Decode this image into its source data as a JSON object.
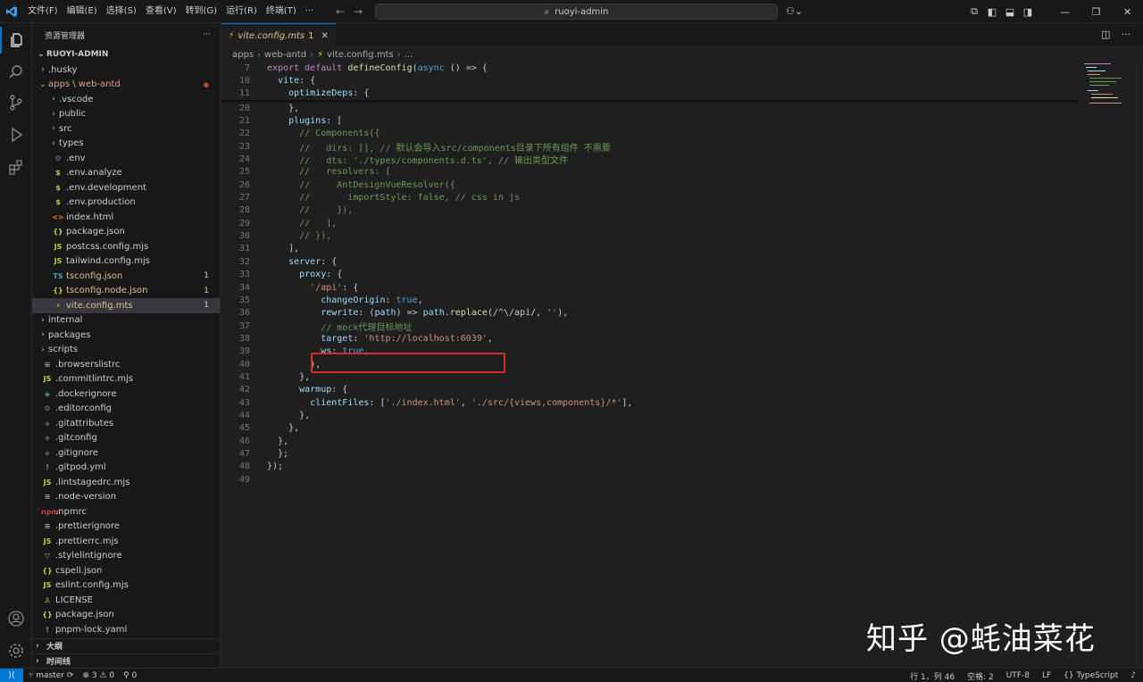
{
  "titlebar": {
    "menu": [
      "文件(F)",
      "编辑(E)",
      "选择(S)",
      "查看(V)",
      "转到(G)",
      "运行(R)",
      "终端(T)",
      "···"
    ],
    "search_text": "ruoyi-admin",
    "copilot": "⚇⌄"
  },
  "sidebar": {
    "title": "资源管理器",
    "more": "···",
    "project": "RUOYI-ADMIN",
    "items": [
      {
        "label": ".husky",
        "icon": "folder",
        "indent": 1,
        "chev": "›"
      },
      {
        "label": "apps \\ web-antd",
        "icon": "folder-open",
        "indent": 1,
        "chev": "⌄",
        "mod": true,
        "badge": "●"
      },
      {
        "label": ".vscode",
        "icon": "folder",
        "indent": 2,
        "chev": "›"
      },
      {
        "label": "public",
        "icon": "folder",
        "indent": 2,
        "chev": "›"
      },
      {
        "label": "src",
        "icon": "folder",
        "indent": 2,
        "chev": "›"
      },
      {
        "label": "types",
        "icon": "folder",
        "indent": 2,
        "chev": "›"
      },
      {
        "label": ".env",
        "icon": "gear",
        "indent": 2
      },
      {
        "label": ".env.analyze",
        "icon": "dollar",
        "indent": 2
      },
      {
        "label": ".env.development",
        "icon": "dollar",
        "indent": 2
      },
      {
        "label": ".env.production",
        "icon": "dollar",
        "indent": 2
      },
      {
        "label": "index.html",
        "icon": "html",
        "indent": 2
      },
      {
        "label": "package.json",
        "icon": "json",
        "indent": 2
      },
      {
        "label": "postcss.config.mjs",
        "icon": "js",
        "indent": 2
      },
      {
        "label": "tailwind.config.mjs",
        "icon": "js",
        "indent": 2
      },
      {
        "label": "tsconfig.json",
        "icon": "ts",
        "indent": 2,
        "warn": true,
        "badge": "1"
      },
      {
        "label": "tsconfig.node.json",
        "icon": "json",
        "indent": 2,
        "warn": true,
        "badge": "1"
      },
      {
        "label": "vite.config.mts",
        "icon": "vite",
        "indent": 2,
        "warn": true,
        "badge": "1",
        "selected": true
      },
      {
        "label": "internal",
        "icon": "folder",
        "indent": 1,
        "chev": "›"
      },
      {
        "label": "packages",
        "icon": "folder",
        "indent": 1,
        "chev": "›"
      },
      {
        "label": "scripts",
        "icon": "folder",
        "indent": 1,
        "chev": "›"
      },
      {
        "label": ".browserslistrc",
        "icon": "lines",
        "indent": 1
      },
      {
        "label": ".commitlintrc.mjs",
        "icon": "js",
        "indent": 1
      },
      {
        "label": ".dockerignore",
        "icon": "docker",
        "indent": 1
      },
      {
        "label": ".editorconfig",
        "icon": "gear",
        "indent": 1
      },
      {
        "label": ".gitattributes",
        "icon": "git",
        "indent": 1
      },
      {
        "label": ".gitconfig",
        "icon": "git",
        "indent": 1
      },
      {
        "label": ".gitignore",
        "icon": "git",
        "indent": 1
      },
      {
        "label": ".gitpod.yml",
        "icon": "yaml",
        "indent": 1
      },
      {
        "label": ".lintstagedrc.mjs",
        "icon": "js",
        "indent": 1
      },
      {
        "label": ".node-version",
        "icon": "lines",
        "indent": 1
      },
      {
        "label": ".npmrc",
        "icon": "npm",
        "indent": 1
      },
      {
        "label": ".prettierignore",
        "icon": "lines",
        "indent": 1
      },
      {
        "label": ".prettierrc.mjs",
        "icon": "js",
        "indent": 1
      },
      {
        "label": ".stylelintignore",
        "icon": "stylelint",
        "indent": 1
      },
      {
        "label": "cspell.json",
        "icon": "json",
        "indent": 1
      },
      {
        "label": "eslint.config.mjs",
        "icon": "js",
        "indent": 1
      },
      {
        "label": "LICENSE",
        "icon": "license",
        "indent": 1
      },
      {
        "label": "package.json",
        "icon": "json",
        "indent": 1
      },
      {
        "label": "pnpm-lock.yaml",
        "icon": "yaml",
        "indent": 1
      }
    ],
    "outline": "大纲",
    "timeline": "时间线"
  },
  "editor": {
    "tab_label": "vite.config.mts",
    "tab_count": "1",
    "tab_close": "✕",
    "breadcrumb": [
      "apps",
      "web-antd",
      "vite.config.mts",
      "..."
    ],
    "lines": [
      {
        "n": "7",
        "t": "export default defineConfig(async () => {"
      },
      {
        "n": "10",
        "t": "  vite: {"
      },
      {
        "n": "11",
        "t": "    optimizeDeps: {"
      },
      {
        "n": "20",
        "t": "    },"
      },
      {
        "n": "21",
        "t": "    plugins: ["
      },
      {
        "n": "22",
        "t": "      // Components({"
      },
      {
        "n": "23",
        "t": "      //   dirs: [], // 默认会导入src/components目录下所有组件 不需要"
      },
      {
        "n": "24",
        "t": "      //   dts: './types/components.d.ts', // 输出类型文件"
      },
      {
        "n": "25",
        "t": "      //   resolvers: ["
      },
      {
        "n": "26",
        "t": "      //     AntDesignVueResolver({"
      },
      {
        "n": "27",
        "t": "      //       importStyle: false, // css in js"
      },
      {
        "n": "28",
        "t": "      //     }),"
      },
      {
        "n": "29",
        "t": "      //   ],"
      },
      {
        "n": "30",
        "t": "      // }),"
      },
      {
        "n": "31",
        "t": "    ],"
      },
      {
        "n": "32",
        "t": "    server: {"
      },
      {
        "n": "33",
        "t": "      proxy: {"
      },
      {
        "n": "34",
        "t": "        '/api': {"
      },
      {
        "n": "35",
        "t": "          changeOrigin: true,"
      },
      {
        "n": "36",
        "t": "          rewrite: (path) => path.replace(/^\\/api/, ''),"
      },
      {
        "n": "37",
        "t": "          // mock代理目标地址"
      },
      {
        "n": "38",
        "t": "          target: 'http://localhost:6039',"
      },
      {
        "n": "39",
        "t": "          ws: true,"
      },
      {
        "n": "40",
        "t": "        },"
      },
      {
        "n": "41",
        "t": "      },"
      },
      {
        "n": "42",
        "t": "      warmup: {"
      },
      {
        "n": "43",
        "t": "        clientFiles: ['./index.html', './src/{views,components}/*'],"
      },
      {
        "n": "44",
        "t": "      },"
      },
      {
        "n": "45",
        "t": "    },"
      },
      {
        "n": "46",
        "t": "  },"
      },
      {
        "n": "47",
        "t": "  };"
      },
      {
        "n": "48",
        "t": "});"
      },
      {
        "n": "49",
        "t": ""
      }
    ]
  },
  "statusbar": {
    "remote": "⟩⟨",
    "branch": "master",
    "sync": "⟳",
    "problems": "⊗ 3 ⚠ 0",
    "ports": "⚲ 0",
    "position": "行 1，列 46",
    "spaces": "空格: 2",
    "encoding": "UTF-8",
    "eol": "LF",
    "language": "{} TypeScript",
    "bell": "🔔"
  },
  "watermark": "知乎 @蚝油菜花",
  "colors": {
    "accent": "#0078d4",
    "highlight": "#d42b2b",
    "warning": "#e2c08d"
  }
}
